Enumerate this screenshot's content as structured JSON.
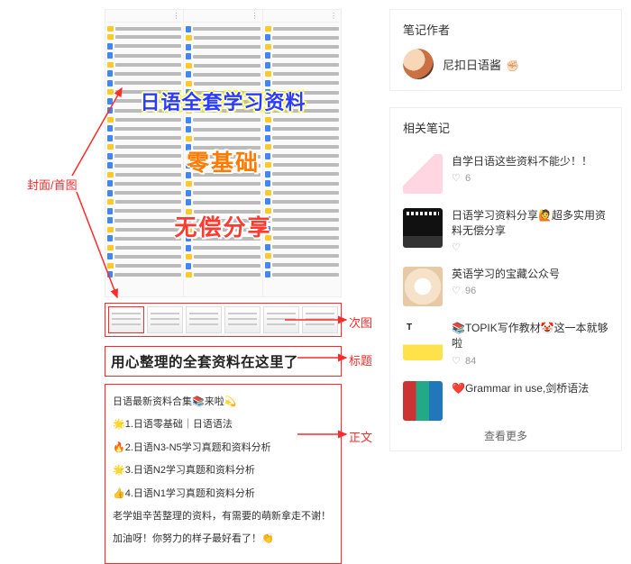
{
  "cover": {
    "line1": "日语全套学习资料",
    "line2": "零基础",
    "line3": "无偿分享"
  },
  "title": "用心整理的全套资料在这里了",
  "body": {
    "p0": "日语最新资料合集📚来啦💫",
    "p1": "🌟1.日语零基础｜日语语法",
    "p2": "🔥2.日语N3-N5学习真题和资料分析",
    "p3": "🌟3.日语N2学习真题和资料分析",
    "p4": "👍4.日语N1学习真题和资料分析",
    "p5": "老学姐辛苦整理的资料，有需要的萌新拿走不谢！",
    "p6": "加油呀！你努力的样子最好看了！👏"
  },
  "callouts": {
    "cover": "封面/首图",
    "thumbs": "次图",
    "title": "标题",
    "body": "正文"
  },
  "sidebar": {
    "author_header": "笔记作者",
    "author_name": "尼扣日语酱",
    "author_hand": "✊🏻",
    "related_header": "相关笔记",
    "items": [
      {
        "title": "自学日语这些资料不能少！！",
        "likes": "6"
      },
      {
        "title": "日语学习资料分享🙋超多实用资料无偿分享",
        "likes": ""
      },
      {
        "title": "英语学习的宝藏公众号",
        "likes": "96"
      },
      {
        "title": "📚TOPIK写作教材🤡这一本就够啦",
        "likes": "84"
      },
      {
        "title": "❤️Grammar in use,剑桥语法",
        "likes": ""
      }
    ],
    "see_more": "查看更多"
  }
}
